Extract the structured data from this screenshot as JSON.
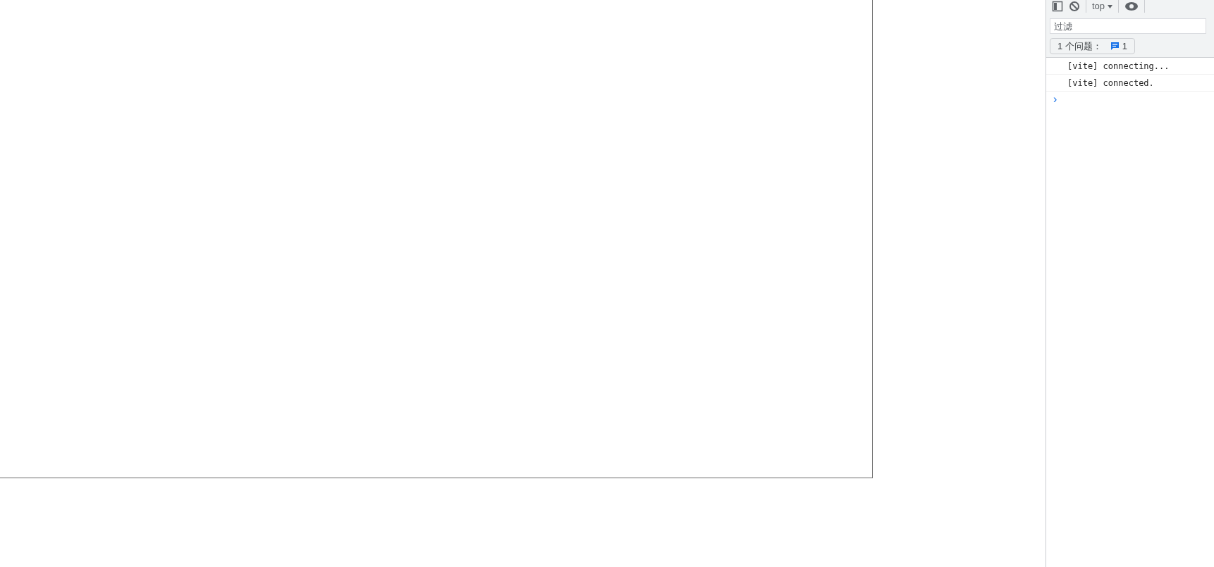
{
  "toolbar": {
    "context": "top"
  },
  "filter": {
    "placeholder": "过滤"
  },
  "issues": {
    "label": "1 个问题：",
    "count": "1"
  },
  "console": {
    "messages": [
      "[vite] connecting...",
      "[vite] connected."
    ],
    "prompt": "›"
  }
}
